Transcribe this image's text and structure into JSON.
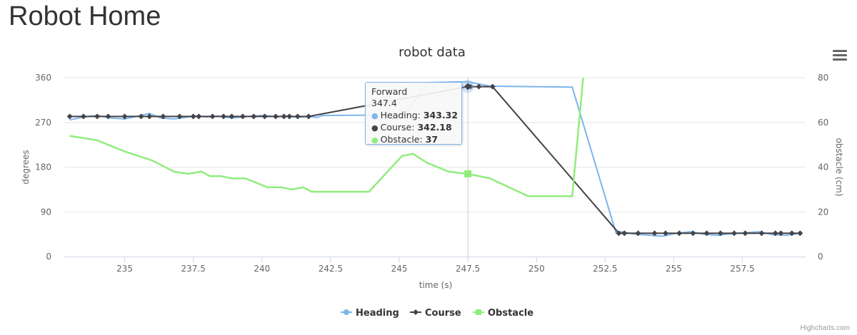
{
  "page": {
    "title": "Robot Home"
  },
  "chart_data": {
    "type": "line",
    "title": "robot data",
    "xlabel": "time (s)",
    "ylabel_left": "degrees",
    "ylabel_right": "obstacle (cm)",
    "xlim": [
      232.8,
      259.8
    ],
    "ylim_left": [
      0,
      360
    ],
    "ylim_right": [
      0,
      80
    ],
    "x_ticks": [
      "235",
      "237.5",
      "240",
      "242.5",
      "245",
      "247.5",
      "250",
      "252.5",
      "255",
      "257.5"
    ],
    "x_tick_values": [
      235,
      237.5,
      240,
      242.5,
      245,
      247.5,
      250,
      252.5,
      255,
      257.5
    ],
    "y_ticks_left": [
      "0",
      "90",
      "180",
      "270",
      "360"
    ],
    "y_tick_values_left": [
      0,
      90,
      180,
      270,
      360
    ],
    "y_ticks_right": [
      "0",
      "20",
      "40",
      "60",
      "80"
    ],
    "y_tick_values_right": [
      0,
      20,
      40,
      60,
      80
    ],
    "grid": true,
    "legend_position": "bottom-center",
    "series": [
      {
        "name": "Heading",
        "axis": "left",
        "color": "#7cb5ec",
        "marker": "circle",
        "x": [
          233.0,
          233.5,
          234.0,
          234.5,
          235.0,
          235.5,
          235.9,
          236.3,
          236.8,
          237.2,
          237.6,
          238.0,
          238.4,
          238.9,
          239.3,
          239.7,
          240.1,
          240.5,
          240.9,
          241.3,
          241.7,
          242.0,
          242.2,
          245.2,
          246.0,
          247.5,
          248.3,
          251.3,
          252.9,
          253.1,
          253.6,
          254.1,
          254.6,
          255.1,
          255.6,
          256.1,
          256.6,
          257.1,
          257.6,
          258.1,
          258.6,
          259.1,
          259.5
        ],
        "values": [
          275,
          281,
          284,
          279,
          277,
          283,
          288,
          279,
          277,
          280,
          283,
          281,
          283,
          279,
          281,
          283,
          284,
          281,
          283,
          280,
          282,
          280,
          284,
          285,
          350,
          352,
          343,
          341,
          47,
          50,
          45,
          43,
          41,
          47,
          50,
          45,
          43,
          46,
          48,
          50,
          44,
          43,
          46
        ]
      },
      {
        "name": "Course",
        "axis": "left",
        "color": "#434348",
        "marker": "diamond",
        "x": [
          233.0,
          233.5,
          234.0,
          234.4,
          235.0,
          235.6,
          235.9,
          236.4,
          237.0,
          237.5,
          237.7,
          238.2,
          238.6,
          238.9,
          239.3,
          239.7,
          240.1,
          240.5,
          240.8,
          241.0,
          241.3,
          241.7,
          247.5,
          247.6,
          247.9,
          248.4,
          253.0,
          253.2,
          253.7,
          254.3,
          254.7,
          255.2,
          255.7,
          256.2,
          256.7,
          257.2,
          257.6,
          258.2,
          258.7,
          258.9,
          259.3,
          259.6
        ],
        "values": [
          282,
          282,
          282,
          282,
          282,
          282,
          282,
          282,
          282,
          282,
          282,
          282,
          282,
          282,
          282,
          282,
          282,
          282,
          282,
          282,
          282,
          282,
          342.18,
          342,
          342,
          342,
          47,
          47,
          47,
          47,
          47,
          47,
          47,
          47,
          47,
          47,
          47,
          47,
          47,
          47,
          47,
          47
        ]
      },
      {
        "name": "Obstacle",
        "axis": "right",
        "color": "#90ed7d",
        "marker": "square",
        "x": [
          233.0,
          234.0,
          235.0,
          236.0,
          236.8,
          237.3,
          237.8,
          238.1,
          238.5,
          238.9,
          239.4,
          239.8,
          240.2,
          240.7,
          241.1,
          241.5,
          241.8,
          242.5,
          243.9,
          245.1,
          245.5,
          246.0,
          246.8,
          247.5,
          248.3,
          249.7,
          251.3,
          251.7
        ],
        "values": [
          54,
          52,
          47,
          43,
          38,
          37,
          38,
          36,
          36,
          35,
          35,
          33,
          31,
          31,
          30,
          31,
          29,
          29,
          29,
          45,
          46,
          42,
          38,
          37,
          35,
          27,
          27,
          80
        ]
      }
    ],
    "tooltip": {
      "x_label": "347.4",
      "title": "Forward",
      "heading": "343.32",
      "course": "342.18",
      "obstacle": "37",
      "heading_label": "Heading:",
      "course_label": "Course:",
      "obstacle_label": "Obstacle:"
    }
  },
  "credits": "Highcharts.com"
}
